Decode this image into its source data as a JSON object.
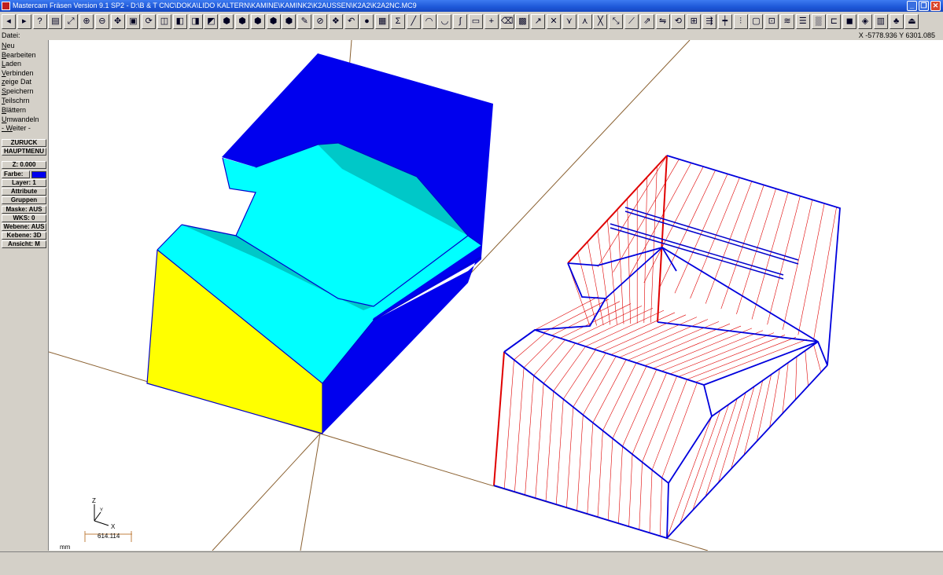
{
  "window": {
    "title": "Mastercam Fräsen Version 9.1  SP2 - D:\\B & T CNC\\DOKA\\LIDO KALTERN\\KAMINE\\KAMINK2\\K2AUSSEN\\K2A2\\K2A2NC.MC9",
    "minimize": "_",
    "maximize": "❐",
    "close": "✕"
  },
  "toolbar": {
    "buttons": [
      {
        "name": "back-icon",
        "glyph": "◂"
      },
      {
        "name": "forward-icon",
        "glyph": "▸"
      },
      {
        "name": "help-icon",
        "glyph": "?"
      },
      {
        "name": "calculator-icon",
        "glyph": "▤"
      },
      {
        "name": "zoom-window-icon",
        "glyph": "⤢"
      },
      {
        "name": "zoom-in-icon",
        "glyph": "⊕"
      },
      {
        "name": "zoom-out-icon",
        "glyph": "⊖"
      },
      {
        "name": "pan-icon",
        "glyph": "✥"
      },
      {
        "name": "fit-screen-icon",
        "glyph": "▣"
      },
      {
        "name": "rotate-view-icon",
        "glyph": "⟳"
      },
      {
        "name": "view-top-icon",
        "glyph": "◫"
      },
      {
        "name": "view-front-icon",
        "glyph": "◧"
      },
      {
        "name": "view-side-icon",
        "glyph": "◨"
      },
      {
        "name": "view-iso-icon",
        "glyph": "◩"
      },
      {
        "name": "cube-top-icon",
        "glyph": "⬢"
      },
      {
        "name": "cube-front-icon",
        "glyph": "⬢"
      },
      {
        "name": "cube-side-icon",
        "glyph": "⬢"
      },
      {
        "name": "cube-iso-icon",
        "glyph": "⬢"
      },
      {
        "name": "cube-custom-icon",
        "glyph": "⬢"
      },
      {
        "name": "pencil-icon",
        "glyph": "✎"
      },
      {
        "name": "no-entry-icon",
        "glyph": "⊘"
      },
      {
        "name": "multicolor-icon",
        "glyph": "❖"
      },
      {
        "name": "undo-icon",
        "glyph": "↶"
      },
      {
        "name": "sphere-icon",
        "glyph": "●"
      },
      {
        "name": "analyze-icon",
        "glyph": "▦"
      },
      {
        "name": "sum-icon",
        "glyph": "Σ"
      },
      {
        "name": "line-icon",
        "glyph": "╱"
      },
      {
        "name": "arc-icon",
        "glyph": "◠"
      },
      {
        "name": "arc-down-icon",
        "glyph": "◡"
      },
      {
        "name": "spline-icon",
        "glyph": "∫"
      },
      {
        "name": "rectangle-icon",
        "glyph": "▭"
      },
      {
        "name": "point-icon",
        "glyph": "+"
      },
      {
        "name": "eraser-icon",
        "glyph": "⌫"
      },
      {
        "name": "box-icon",
        "glyph": "▩"
      },
      {
        "name": "arrow-icon",
        "glyph": "↗"
      },
      {
        "name": "trim-icon",
        "glyph": "✕"
      },
      {
        "name": "trim-two-icon",
        "glyph": "⋎"
      },
      {
        "name": "trim-three-icon",
        "glyph": "⋏"
      },
      {
        "name": "break-icon",
        "glyph": "╳"
      },
      {
        "name": "extend-icon",
        "glyph": "⤡"
      },
      {
        "name": "join-icon",
        "glyph": "⟋"
      },
      {
        "name": "offset-icon",
        "glyph": "⇗"
      },
      {
        "name": "mirror-icon",
        "glyph": "⇋"
      },
      {
        "name": "rotate-icon",
        "glyph": "⟲"
      },
      {
        "name": "scale-icon",
        "glyph": "⊞"
      },
      {
        "name": "translate-icon",
        "glyph": "⇶"
      },
      {
        "name": "toolpath-icon",
        "glyph": "┿"
      },
      {
        "name": "drill-icon",
        "glyph": "⫶"
      },
      {
        "name": "pocket-icon",
        "glyph": "▢"
      },
      {
        "name": "contour-icon",
        "glyph": "⊡"
      },
      {
        "name": "surface-icon",
        "glyph": "≋"
      },
      {
        "name": "operations-icon",
        "glyph": "☰"
      },
      {
        "name": "verify-icon",
        "glyph": "▒"
      },
      {
        "name": "lathe-icon",
        "glyph": "⊏"
      },
      {
        "name": "solid-icon",
        "glyph": "◼"
      },
      {
        "name": "material-icon",
        "glyph": "◈"
      },
      {
        "name": "gallery-icon",
        "glyph": "▥"
      },
      {
        "name": "tree-icon",
        "glyph": "♣"
      },
      {
        "name": "exit-icon",
        "glyph": "⏏"
      }
    ]
  },
  "prompt": {
    "label": "Datei:",
    "coords": "X -5778.936   Y 6301.085"
  },
  "menu": {
    "items": [
      {
        "name": "menu-item-neu",
        "ul": "N",
        "rest": "eu"
      },
      {
        "name": "menu-item-bearbeiten",
        "ul": "B",
        "rest": "earbeiten"
      },
      {
        "name": "menu-item-laden",
        "ul": "L",
        "rest": "aden"
      },
      {
        "name": "menu-item-verbinden",
        "ul": "V",
        "rest": "erbinden"
      },
      {
        "name": "menu-item-zeige-dat",
        "ul": "z",
        "rest": "eige Dat"
      },
      {
        "name": "menu-item-speichern",
        "ul": "S",
        "rest": "peichern"
      },
      {
        "name": "menu-item-teilschrn",
        "ul": "T",
        "rest": "eilschrn"
      },
      {
        "name": "menu-item-blattern",
        "ul": "B",
        "rest": "lättern"
      },
      {
        "name": "menu-item-umwandeln",
        "ul": "U",
        "rest": "mwandeln"
      },
      {
        "name": "menu-item-weiter",
        "ul": "- W",
        "rest": "eiter -"
      }
    ],
    "back_label": "ZURÜCK",
    "main_label": "HAUPTMENÜ",
    "z": "Z:  0.000",
    "farbe": "Farbe:",
    "layer": "Layer:  1",
    "attribute": "Attribute",
    "gruppen": "Gruppen",
    "maske": "Maske: AUS",
    "wks": "WKS:  0",
    "webene": "Webene: AUS",
    "kebene": "Kebene: 3D",
    "ansicht": "Ansicht:  M",
    "colors": {
      "farbe": "#0000ee"
    }
  },
  "viewport": {
    "axis_labels": {
      "z": "Z",
      "y": "Y",
      "x": "X"
    },
    "scale_value": "614.114",
    "unit": "mm",
    "colors": {
      "top_face": "#00ffff",
      "shaded_face": "#00c8c8",
      "side_face": "#0000ee",
      "front_face": "#ffff00",
      "edge": "#0000cc",
      "wire_blue": "#0000dd",
      "wire_red": "#e00000",
      "axis_line": "#8a6030"
    }
  }
}
